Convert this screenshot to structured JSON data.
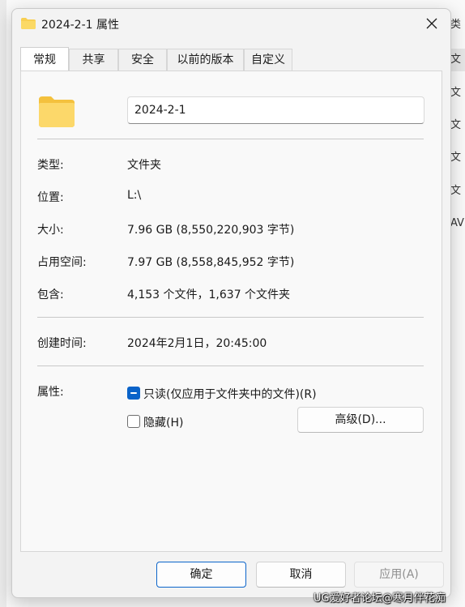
{
  "background": {
    "rows": [
      "类",
      "文",
      "文",
      "文",
      "文",
      "文",
      "AV"
    ]
  },
  "dialog": {
    "title": "2024-2-1 属性",
    "close_glyph": "✕",
    "tabs": [
      {
        "label": "常规",
        "active": true
      },
      {
        "label": "共享",
        "active": false
      },
      {
        "label": "安全",
        "active": false
      },
      {
        "label": "以前的版本",
        "active": false
      },
      {
        "label": "自定义",
        "active": false
      }
    ],
    "general": {
      "folder_name": "2024-2-1",
      "type_label": "类型:",
      "type_value": "文件夹",
      "location_label": "位置:",
      "location_value": "L:\\",
      "size_label": "大小:",
      "size_value": "7.96 GB (8,550,220,903 字节)",
      "size_on_disk_label": "占用空间:",
      "size_on_disk_value": "7.97 GB (8,558,845,952 字节)",
      "contains_label": "包含:",
      "contains_value": "4,153 个文件，1,637 个文件夹",
      "created_label": "创建时间:",
      "created_value": "2024年2月1日，20:45:00",
      "attributes_label": "属性:",
      "readonly_label": "只读(仅应用于文件夹中的文件)(R)",
      "readonly_state": "indeterminate",
      "hidden_label": "隐藏(H)",
      "hidden_state": "unchecked",
      "advanced_button": "高级(D)..."
    },
    "footer": {
      "ok": "确定",
      "cancel": "取消",
      "apply": "应用(A)"
    }
  },
  "watermark": "UG爱好者论坛@寒月伴花痴",
  "colors": {
    "accent": "#0a63c9",
    "folder_yellow": "#f8cf52",
    "dialog_bg": "#f3f3f3"
  }
}
